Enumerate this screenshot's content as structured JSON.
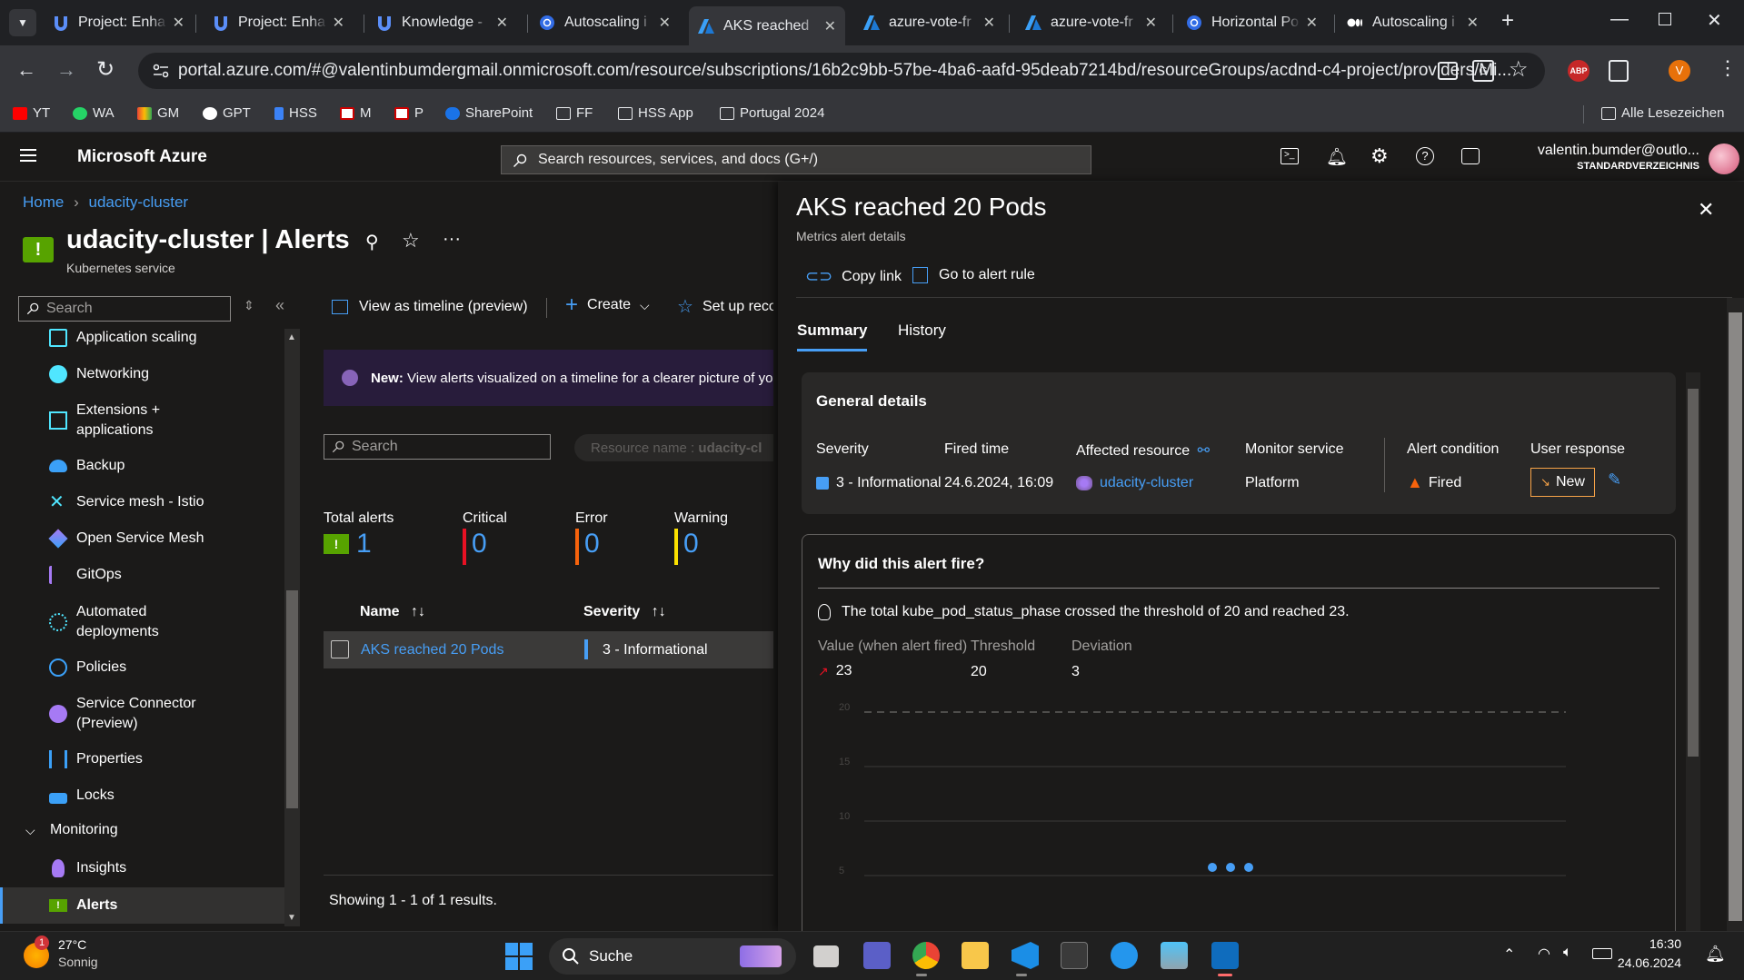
{
  "browser": {
    "tabs": [
      {
        "title": "Project: Enha",
        "icon": "udacity-icon"
      },
      {
        "title": "Project: Enha",
        "icon": "udacity-icon"
      },
      {
        "title": "Knowledge -",
        "icon": "udacity-icon"
      },
      {
        "title": "Autoscaling i",
        "icon": "kubernetes-icon"
      },
      {
        "title": "AKS reached",
        "icon": "azure-icon",
        "active": true
      },
      {
        "title": "azure-vote-fr",
        "icon": "azure-icon"
      },
      {
        "title": "azure-vote-fr",
        "icon": "azure-icon"
      },
      {
        "title": "Horizontal Po",
        "icon": "kubernetes-icon"
      },
      {
        "title": "Autoscaling i",
        "icon": "medium-icon"
      }
    ],
    "url": "portal.azure.com/#@valentinbumdergmail.onmicrosoft.com/resource/subscriptions/16b2c9bb-57be-4ba6-aafd-95deab7214bd/resourceGroups/acdnd-c4-project/providers/Mi...",
    "profile_initial": "V",
    "abp_label": "ABP",
    "bookmarks": [
      "YT",
      "WA",
      "GM",
      "GPT",
      "HSS",
      "M",
      "P",
      "SharePoint",
      "FF",
      "HSS App",
      "Portugal 2024"
    ],
    "all_bookmarks": "Alle Lesezeichen"
  },
  "azure": {
    "brand": "Microsoft Azure",
    "search_placeholder": "Search resources, services, and docs (G+/)",
    "account_email": "valentin.bumder@outlo...",
    "account_directory": "STANDARDVERZEICHNIS"
  },
  "breadcrumb": {
    "home": "Home",
    "cluster": "udacity-cluster"
  },
  "page": {
    "title": "udacity-cluster | Alerts",
    "subtitle": "Kubernetes service"
  },
  "sidebar": {
    "search_placeholder": "Search",
    "items": [
      {
        "label": "Application scaling",
        "icon": "scaling-icon"
      },
      {
        "label": "Networking",
        "icon": "network-icon"
      },
      {
        "label": "Extensions +\napplications",
        "icon": "extensions-icon"
      },
      {
        "label": "Backup",
        "icon": "cloud-icon"
      },
      {
        "label": "Service mesh - Istio",
        "icon": "mesh-icon"
      },
      {
        "label": "Open Service Mesh",
        "icon": "osm-icon"
      },
      {
        "label": "GitOps",
        "icon": "gitops-icon"
      },
      {
        "label": "Automated\ndeployments",
        "icon": "deploy-icon"
      },
      {
        "label": "Policies",
        "icon": "policy-icon"
      },
      {
        "label": "Service Connector\n(Preview)",
        "icon": "connector-icon"
      },
      {
        "label": "Properties",
        "icon": "properties-icon"
      },
      {
        "label": "Locks",
        "icon": "lock-icon"
      }
    ],
    "section": "Monitoring",
    "monitoring_items": [
      {
        "label": "Insights",
        "icon": "bulb-icon"
      },
      {
        "label": "Alerts",
        "icon": "alert-icon",
        "selected": true
      }
    ]
  },
  "toolbar": {
    "view_timeline": "View as timeline (preview)",
    "create": "Create",
    "setup": "Set up reco"
  },
  "banner": {
    "bold": "New:",
    "text": "View alerts visualized on a timeline for a clearer picture of you"
  },
  "filters": {
    "search_placeholder": "Search",
    "resource_name_label": "Resource name :",
    "resource_name_value": "udacity-cl"
  },
  "kpis": [
    {
      "label": "Total alerts",
      "value": "1",
      "color": "#57a300"
    },
    {
      "label": "Critical",
      "value": "0",
      "color": "#e81123"
    },
    {
      "label": "Error",
      "value": "0",
      "color": "#f7630c"
    },
    {
      "label": "Warning",
      "value": "0",
      "color": "#fce100"
    }
  ],
  "table": {
    "headers": [
      "Name",
      "Severity"
    ],
    "rows": [
      {
        "name": "AKS reached 20 Pods",
        "severity": "3 - Informational"
      }
    ],
    "footer": "Showing 1 - 1 of 1 results."
  },
  "panel": {
    "title": "AKS reached 20 Pods",
    "subtitle": "Metrics alert details",
    "copy_link": "Copy link",
    "go_to_rule": "Go to alert rule",
    "tabs": [
      "Summary",
      "History"
    ],
    "general": {
      "heading": "General details",
      "severity_label": "Severity",
      "severity_value": "3 - Informational",
      "fired_label": "Fired time",
      "fired_value": "24.6.2024, 16:09",
      "resource_label": "Affected resource",
      "resource_value": "udacity-cluster",
      "monitor_label": "Monitor service",
      "monitor_value": "Platform",
      "condition_label": "Alert condition",
      "condition_value": "Fired",
      "response_label": "User response",
      "response_value": "New"
    },
    "why": {
      "heading": "Why did this alert fire?",
      "text": "The total kube_pod_status_phase crossed the threshold of 20 and reached 23.",
      "value_label": "Value (when alert fired)",
      "value": "23",
      "threshold_label": "Threshold",
      "threshold": "20",
      "deviation_label": "Deviation",
      "deviation": "3"
    }
  },
  "chart_data": {
    "type": "line",
    "title": "",
    "xlabel": "",
    "ylabel": "",
    "yticks": [
      "20",
      "15",
      "10",
      "5"
    ],
    "threshold": 20,
    "series": [],
    "loading": true
  },
  "taskbar": {
    "weather_temp": "27°C",
    "weather_text": "Sonnig",
    "weather_badge": "1",
    "search": "Suche",
    "time": "16:30",
    "date": "24.06.2024"
  }
}
